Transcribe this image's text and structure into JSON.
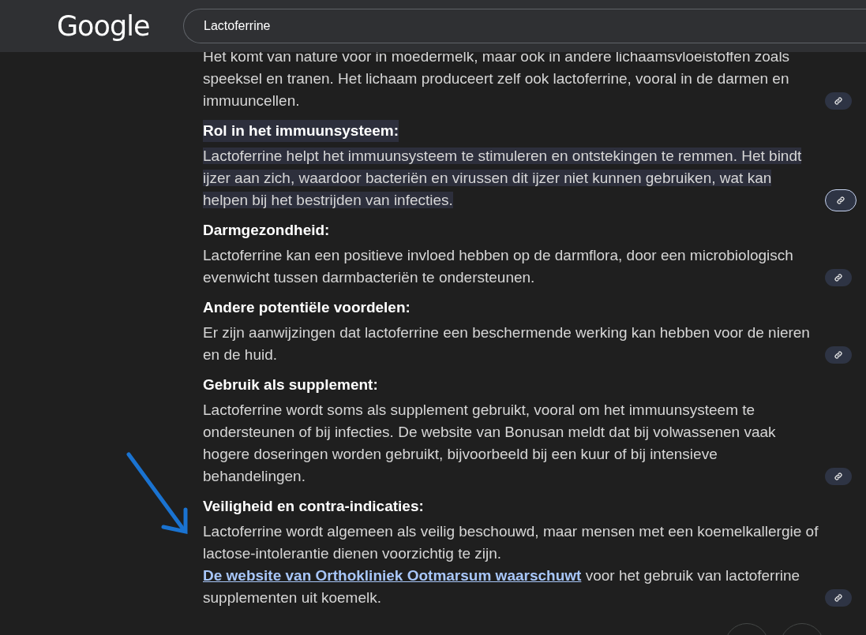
{
  "header": {
    "logo": "Google",
    "search": {
      "value": "Lactoferrine"
    }
  },
  "sections": [
    {
      "body": "Het komt van nature voor in moedermelk, maar ook in andere lichaamsvloeistoffen zoals speeksel en tranen. Het lichaam produceert zelf ook lactoferrine, vooral in de darmen en immuuncellen.",
      "highlighted": false
    },
    {
      "heading": "Rol in het immuunsysteem:",
      "body": "Lactoferrine helpt het immuunsysteem te stimuleren en ontstekingen te remmen. Het bindt ijzer aan zich, waardoor bacteriën en virussen dit ijzer niet kunnen gebruiken, wat kan helpen bij het bestrijden van infecties.",
      "highlighted": true
    },
    {
      "heading": "Darmgezondheid:",
      "body": "Lactoferrine kan een positieve invloed hebben op de darmflora, door een microbiologisch evenwicht tussen darmbacteriën te ondersteunen.",
      "highlighted": false
    },
    {
      "heading": "Andere potentiële voordelen:",
      "body": "Er zijn aanwijzingen dat lactoferrine een beschermende werking kan hebben voor de nieren en de huid.",
      "highlighted": false
    },
    {
      "heading": "Gebruik als supplement:",
      "body": "Lactoferrine wordt soms als supplement gebruikt, vooral om het immuunsysteem te ondersteunen of bij infecties. De website van Bonusan meldt dat bij volwassenen vaak hogere doseringen worden gebruikt, bijvoorbeeld bij een kuur of bij intensieve behandelingen.",
      "highlighted": false
    },
    {
      "heading": "Veiligheid en contra-indicaties:",
      "body": "Lactoferrine wordt algemeen als veilig beschouwd, maar mensen met een koemelkallergie of lactose-intolerantie dienen voorzichtig te zijn.",
      "link": "De website van Orthokliniek Ootmarsum waarschuwt",
      "body_after": "voor het gebruik van lactoferrine supplementen uit koemelk.",
      "highlighted": false
    }
  ]
}
